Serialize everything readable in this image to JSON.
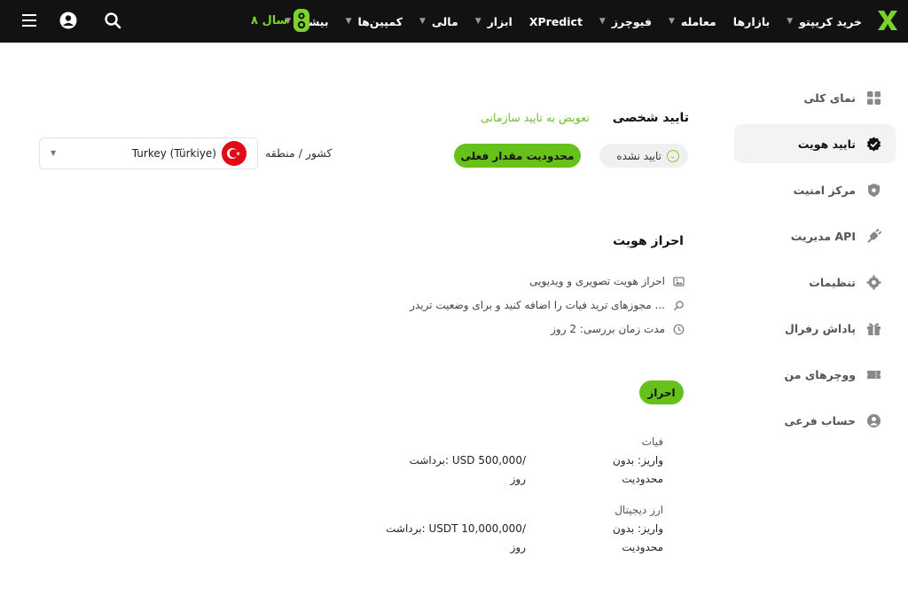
{
  "topbar": {
    "nav": [
      {
        "label": "خرید کریپتو",
        "has_dropdown": true
      },
      {
        "label": "بازارها",
        "has_dropdown": false
      },
      {
        "label": "معامله",
        "has_dropdown": true
      },
      {
        "label": "فیوچرز",
        "has_dropdown": true
      },
      {
        "label": "XPredict",
        "has_dropdown": false
      },
      {
        "label": "ابزار",
        "has_dropdown": true
      },
      {
        "label": "مالی",
        "has_dropdown": true
      },
      {
        "label": "کمپین‌ها",
        "has_dropdown": true
      },
      {
        "label": "بیشتر",
        "has_dropdown": true
      }
    ],
    "anniversary_text": "۸ سال",
    "anniversary_badge": "8",
    "accent_color": "#7ad32b"
  },
  "sidebar": {
    "items": [
      {
        "label": "نمای کلی",
        "icon": "grid-icon"
      },
      {
        "label": "تایید هویت",
        "icon": "verified-badge-icon",
        "active": true
      },
      {
        "label": "مرکز امنیت",
        "icon": "shield-icon"
      },
      {
        "label": "مدیریت API",
        "icon": "plug-icon"
      },
      {
        "label": "تنظیمات",
        "icon": "gear-icon"
      },
      {
        "label": "پاداش رفرال",
        "icon": "gift-icon"
      },
      {
        "label": "ووچرهای من",
        "icon": "ticket-icon"
      },
      {
        "label": "حساب فرعی",
        "icon": "user-circle-icon"
      }
    ]
  },
  "header": {
    "personal_tab": "تایید شخصی",
    "switch_link": "تعویض به تایید سازمانی",
    "status": "تایید نشده",
    "limit_button": "محدودیت مقدار فعلی",
    "country_label": "کشور / منطقه",
    "country_value": "Turkey (Türkiye)"
  },
  "kyc": {
    "title": "احراز هویت",
    "features": [
      {
        "text": "احراز هویت تصویری و ویدیویی",
        "icon": "image-icon"
      },
      {
        "text": "مجوزهای ترید فیات را اضافه کنید و برای وضعیت تریدر ...",
        "icon": "search-icon"
      },
      {
        "text": "مدت زمان بررسی: 2 روز",
        "icon": "clock-icon"
      }
    ],
    "verify_button": "احراز",
    "limits": [
      {
        "category": "فیات",
        "deposit_line1": "واریز: بدون",
        "deposit_line2": "محدودیت",
        "withdraw_line1": "برداشت: USD 500,000/",
        "withdraw_line2": "روز"
      },
      {
        "category": "ارز دیجیتال",
        "deposit_line1": "واریز: بدون",
        "deposit_line2": "محدودیت",
        "withdraw_line1": "برداشت: USDT 10,000,000/",
        "withdraw_line2": "روز"
      }
    ]
  }
}
